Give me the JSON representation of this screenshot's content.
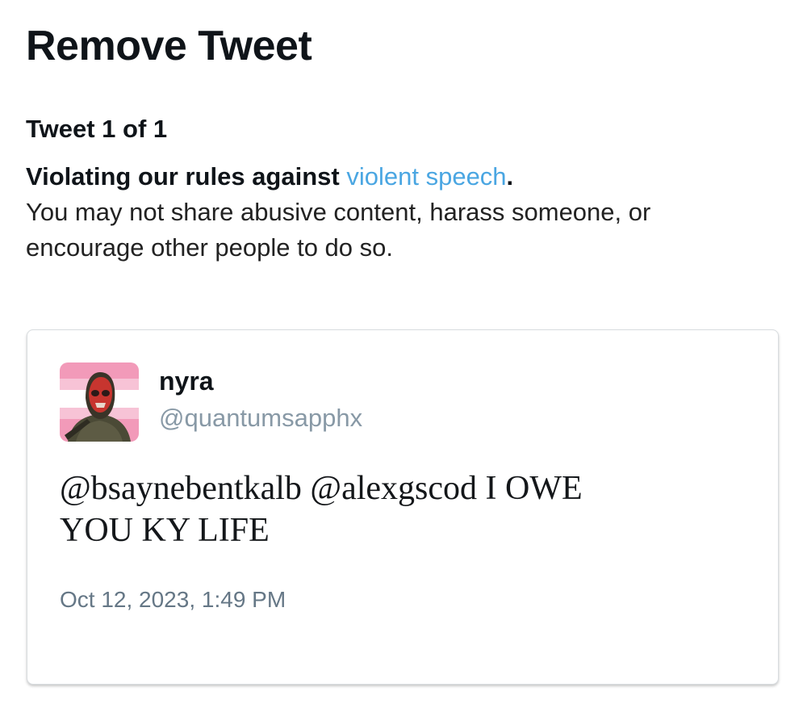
{
  "page": {
    "title": "Remove Tweet",
    "tweet_count": "Tweet 1 of 1"
  },
  "violation": {
    "prefix": "Violating our rules against",
    "rule_link": "violent speech",
    "suffix": ".",
    "description_line1": "You may not share abusive content, harass someone, or",
    "description_line2": "encourage other people to do so."
  },
  "tweet": {
    "display_name": "nyra",
    "handle": "@quantumsapphx",
    "text_line1": "@bsaynebentkalb @alexgscod I OWE",
    "text_line2": "YOU KY LIFE",
    "timestamp": "Oct 12, 2023, 1:49 PM"
  },
  "colors": {
    "link": "#4aa6e2",
    "handle": "#8899a6",
    "avatar_stripe_pink": "#f29ab9",
    "avatar_stripe_white": "#ffffff"
  },
  "icons": {
    "avatar": "profile-photo-masked-soldier"
  }
}
